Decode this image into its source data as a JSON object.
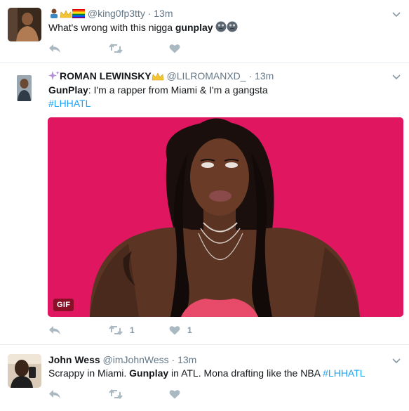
{
  "tweets": [
    {
      "handle": "@king0fp3tty",
      "sep": "·",
      "time": "13m",
      "text_plain": "What's wrong with this nigga ",
      "text_bold": "gunplay",
      "emojis": [
        "person-raising-hand-emoji",
        "crown-emoji",
        "rainbow-flag-emoji",
        "face-with-rolling-eyes-emoji",
        "face-with-rolling-eyes-emoji"
      ]
    },
    {
      "fullname": "ROMAN LEWINSKY",
      "handle": "@LILROMANXD_",
      "sep": "·",
      "time": "13m",
      "text_bold": "GunPlay",
      "text_plain": ": I'm a rapper from Miami & I'm a gangsta",
      "hashtag": "#LHHATL",
      "gif_label": "GIF",
      "retweet_count": "1",
      "like_count": "1",
      "emojis": [
        "sparkles-emoji",
        "crown-emoji"
      ]
    },
    {
      "fullname": "John Wess",
      "handle": "@imJohnWess",
      "sep": "·",
      "time": "13m",
      "text_plain_1": "Scrappy in Miami. ",
      "text_bold": "Gunplay",
      "text_plain_2": " in ATL. Mona drafting like the NBA ",
      "hashtag": "#LHHATL"
    }
  ],
  "colors": {
    "link": "#1da1f2",
    "muted": "#657786",
    "action": "#aab8c2",
    "gif_bg": "#e01661"
  }
}
